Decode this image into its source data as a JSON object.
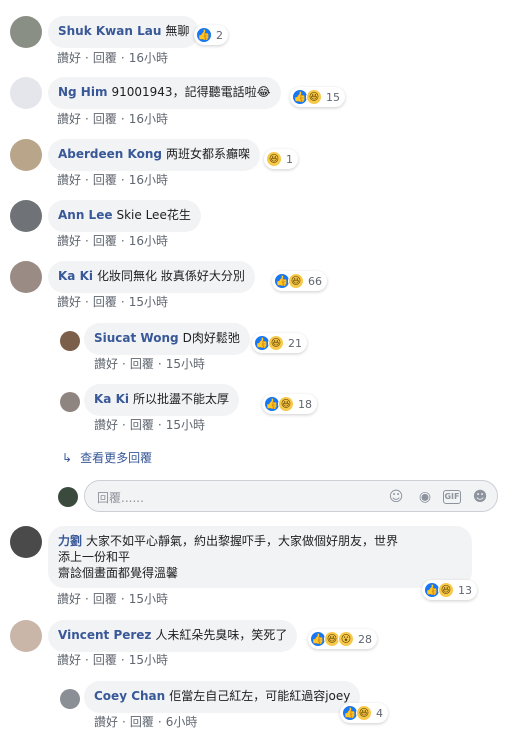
{
  "labels": {
    "like": "讚好",
    "reply": "回覆"
  },
  "comments": [
    {
      "author": "Shuk Kwan Lau",
      "text": "無聊",
      "time": "16小時",
      "reactions": {
        "count": "2",
        "types": [
          "like"
        ]
      }
    },
    {
      "author": "Ng Him",
      "text": "91001943，記得聽電話啦😂",
      "time": "16小時",
      "reactions": {
        "count": "15",
        "types": [
          "like",
          "haha"
        ]
      }
    },
    {
      "author": "Aberdeen Kong",
      "text": "两班女都系癲㗎",
      "time": "16小時",
      "reactions": {
        "count": "1",
        "types": [
          "haha"
        ]
      }
    },
    {
      "author": "Ann Lee",
      "text": "Skie Lee花生",
      "time": "16小時",
      "reactions": null
    },
    {
      "author": "Ka Ki",
      "text": "化妝同無化 妝真係好大分別",
      "time": "15小時",
      "reactions": {
        "count": "66",
        "types": [
          "like",
          "haha"
        ]
      }
    },
    {
      "author": "Siucat Wong",
      "text": "D肉好鬆弛",
      "time": "15小時",
      "reactions": {
        "count": "21",
        "types": [
          "like",
          "haha"
        ]
      }
    },
    {
      "author": "Ka Ki",
      "text": "所以批盪不能太厚",
      "time": "15小時",
      "reactions": {
        "count": "18",
        "types": [
          "like",
          "haha"
        ]
      }
    },
    {
      "author": "力劉",
      "text_line1": "大家不如平心靜氣，約出黎握吓手，大家做個好朋友，世界",
      "text_line2": "添上一份和平",
      "text_line3": "齋諗個畫面都覺得溫馨",
      "time": "15小時",
      "reactions": {
        "count": "13",
        "types": [
          "like",
          "haha"
        ]
      }
    },
    {
      "author": "Vincent Perez",
      "text": "人未紅朵先臭味，笑死了",
      "time": "15小時",
      "reactions": {
        "count": "28",
        "types": [
          "like",
          "haha",
          "wow"
        ]
      }
    },
    {
      "author": "Coey Chan",
      "text": "佢當左自己紅左，可能紅過容joey",
      "time": "6小時",
      "reactions": {
        "count": "4",
        "types": [
          "like",
          "haha"
        ]
      }
    }
  ],
  "more_replies": "查看更多回覆",
  "compose": {
    "placeholder": "回覆......"
  },
  "colors": {
    "author": "#385898",
    "bubble": "#f2f3f5",
    "meta": "#606770",
    "like": "#1877f2",
    "haha": "#f7c94b"
  },
  "icons": {
    "emoji": "emoji-icon",
    "camera": "camera-icon",
    "gif": "gif-icon",
    "sticker": "sticker-icon",
    "reply_arrow": "reply-arrow-icon"
  }
}
